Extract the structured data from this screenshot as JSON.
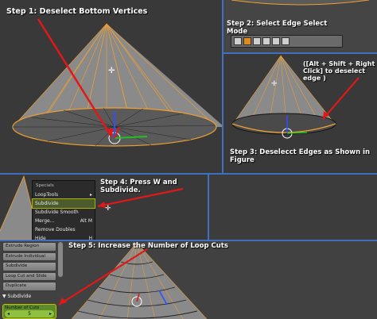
{
  "steps": {
    "s1": "Step 1: Deselect Bottom Vertices",
    "s2": "Step 2: Select Edge Select Mode",
    "s2b": "([Alt + Shift + Right Click] to deselect edge )",
    "s3": "Step 3: Deselecct Edges as Shown in Figure",
    "s4": "Step 4: Press W and Subdivide.",
    "s5": "Step 5: Increase the Number of Loop Cuts"
  },
  "specials_menu": {
    "title": "Specials",
    "items": [
      {
        "label": "LoopTools",
        "shortcut": "▸"
      },
      {
        "label": "Subdivide",
        "shortcut": ""
      },
      {
        "label": "Subdivide Smooth",
        "shortcut": ""
      },
      {
        "label": "Merge...",
        "shortcut": "Alt M"
      },
      {
        "label": "Remove Doubles",
        "shortcut": ""
      },
      {
        "label": "Hide",
        "shortcut": "H"
      }
    ]
  },
  "tool_shelf": {
    "buttons": [
      "Extrude Region",
      "Extrude Individual",
      "Subdivide",
      "Loop Cut and Slide",
      "Duplicate"
    ],
    "section_title": "Subdivide",
    "field_label": "Number of Cuts",
    "field_value": "5"
  },
  "colors": {
    "selected": "#f0a030",
    "divider": "#3f6fbf",
    "arrow": "#e01818",
    "axis_z": "#3050ff",
    "axis_y": "#20c020"
  }
}
